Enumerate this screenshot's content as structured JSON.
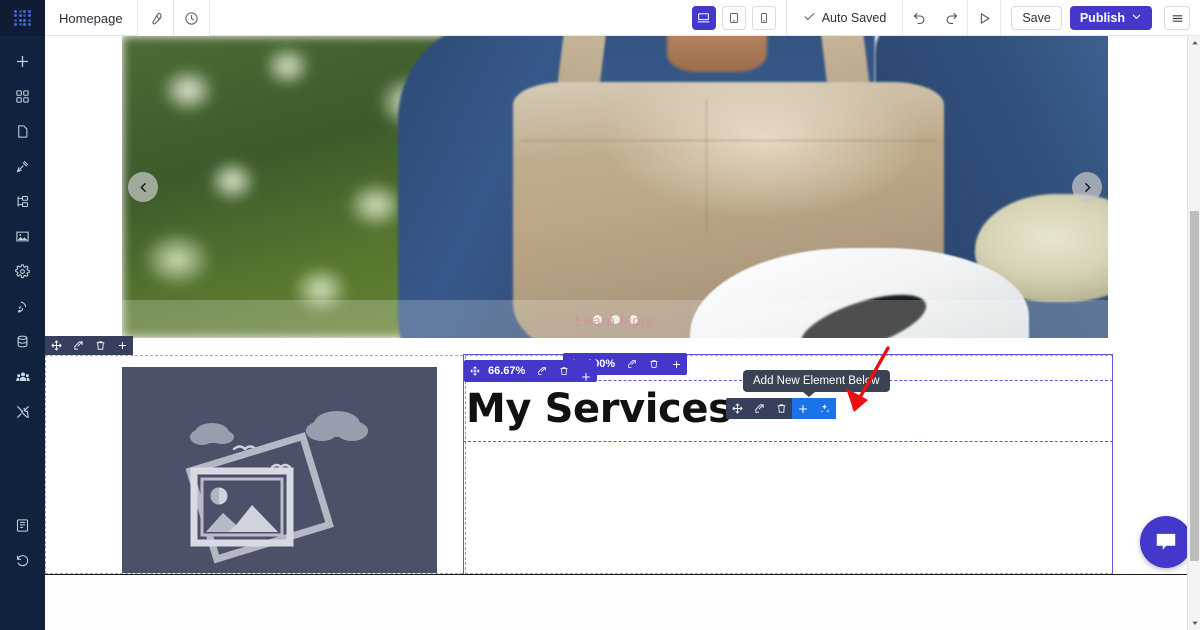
{
  "topbar": {
    "logo_icon": "grid-dots-logo",
    "page_name": "Homepage",
    "settings_icon": "wrench-icon",
    "history_icon": "clock-icon",
    "devices": [
      {
        "name": "desktop",
        "icon": "desktop-icon",
        "active": true
      },
      {
        "name": "tablet",
        "icon": "tablet-icon",
        "active": false
      },
      {
        "name": "mobile",
        "icon": "mobile-icon",
        "active": false
      }
    ],
    "autosave_label": "Auto Saved",
    "autosave_icon": "check-icon",
    "undo_icon": "undo-icon",
    "redo_icon": "redo-icon",
    "preview_icon": "play-triangle-icon",
    "save_label": "Save",
    "publish_label": "Publish",
    "publish_caret_icon": "chevron-down-icon",
    "menu_icon": "hamburger-menu-icon",
    "accent_color": "#4338ca"
  },
  "sidebar": {
    "bg_color": "#10223d",
    "items": [
      {
        "name": "add",
        "icon": "plus-icon"
      },
      {
        "name": "blocks",
        "icon": "blocks-grid-icon"
      },
      {
        "name": "pages",
        "icon": "page-icon"
      },
      {
        "name": "theme",
        "icon": "magic-wand-icon"
      },
      {
        "name": "structure",
        "icon": "sitemap-icon"
      },
      {
        "name": "media",
        "icon": "image-icon"
      },
      {
        "name": "settings",
        "icon": "gear-icon"
      },
      {
        "name": "integrations",
        "icon": "broadcast-icon"
      },
      {
        "name": "database",
        "icon": "database-icon"
      },
      {
        "name": "users",
        "icon": "users-group-icon"
      },
      {
        "name": "tools",
        "icon": "tools-icon"
      }
    ],
    "bottom_items": [
      {
        "name": "docs",
        "icon": "book-icon"
      },
      {
        "name": "revisions",
        "icon": "history-revert-icon"
      }
    ]
  },
  "canvas": {
    "hero": {
      "prev_icon": "chevron-left-icon",
      "next_icon": "chevron-right-icon",
      "cta_label": "Learn More",
      "slide_dots": 3
    },
    "section_toolbar": {
      "icons": [
        "move-icon",
        "edit-icon",
        "trash-icon",
        "plus-icon"
      ]
    },
    "column_toolbar": {
      "percent_label": "66.67%",
      "icons": [
        "move-icon",
        "edit-icon",
        "trash-icon",
        "plus-icon"
      ]
    },
    "row_toolbar": {
      "percent_label": "100%",
      "icons": [
        "move-icon",
        "edit-icon",
        "trash-icon",
        "plus-icon"
      ]
    },
    "heading_text": "My Services",
    "image_placeholder_icon": "image-placeholder-illustration",
    "element_toolbar": {
      "icons": [
        "move-icon",
        "edit-icon",
        "trash-icon",
        "plus-icon",
        "ai-sparkle-icon"
      ],
      "highlighted": "plus-icon"
    },
    "tooltip_text": "Add New Element Below",
    "cursor_icon": "red-arrow-pointer"
  },
  "chat_widget": {
    "icon": "chat-bubble-icon",
    "color": "#4338ca"
  },
  "scrollbar": {
    "up_icon": "caret-up-icon",
    "down_icon": "caret-down-icon"
  }
}
